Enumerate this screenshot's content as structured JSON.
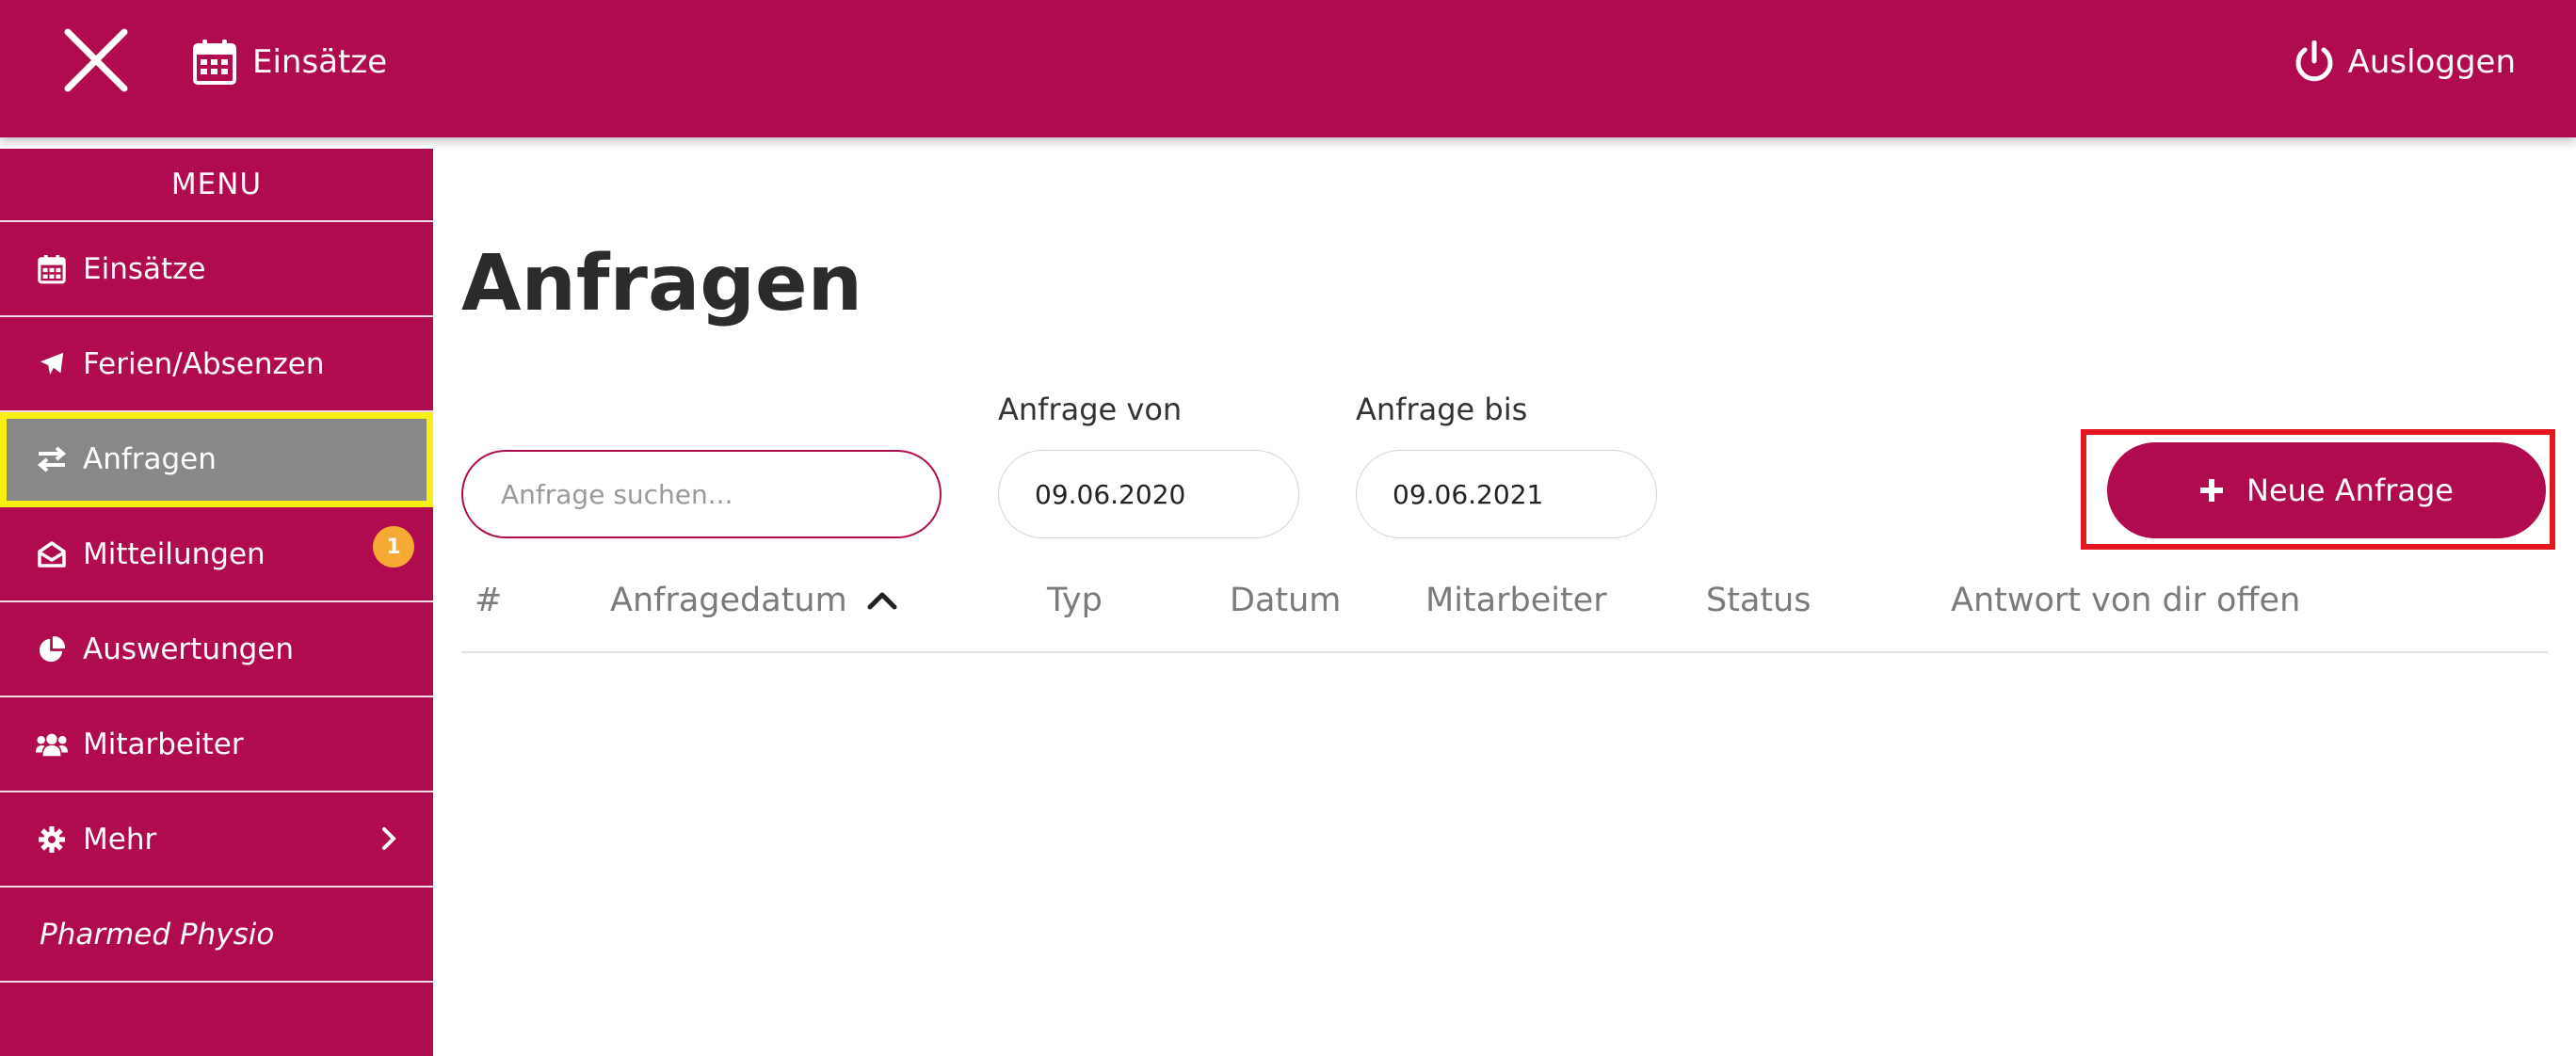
{
  "topbar": {
    "nav_label": "Einsätze",
    "logout_label": "Ausloggen"
  },
  "sidebar": {
    "menu_title": "MENU",
    "items": [
      {
        "label": "Einsätze",
        "icon": "calendar-icon"
      },
      {
        "label": "Ferien/Absenzen",
        "icon": "plane-icon"
      },
      {
        "label": "Anfragen",
        "icon": "exchange-icon"
      },
      {
        "label": "Mitteilungen",
        "icon": "envelope-open-icon",
        "badge": "1"
      },
      {
        "label": "Auswertungen",
        "icon": "pie-chart-icon"
      },
      {
        "label": "Mitarbeiter",
        "icon": "users-icon"
      },
      {
        "label": "Mehr",
        "icon": "gear-icon"
      }
    ],
    "company": "Pharmed Physio"
  },
  "main": {
    "title": "Anfragen",
    "search_placeholder": "Anfrage suchen...",
    "from_label": "Anfrage von",
    "from_value": "09.06.2020",
    "to_label": "Anfrage bis",
    "to_value": "09.06.2021",
    "new_button": "Neue Anfrage",
    "columns": [
      "#",
      "Anfragedatum",
      "Typ",
      "Datum",
      "Mitarbeiter",
      "Status",
      "Antwort von dir offen"
    ]
  },
  "colors": {
    "brand": "#b00b4e",
    "active_item": "#888888",
    "highlight_yellow": "#f5ef14",
    "highlight_red": "#e5171e",
    "badge": "#f6a935"
  }
}
